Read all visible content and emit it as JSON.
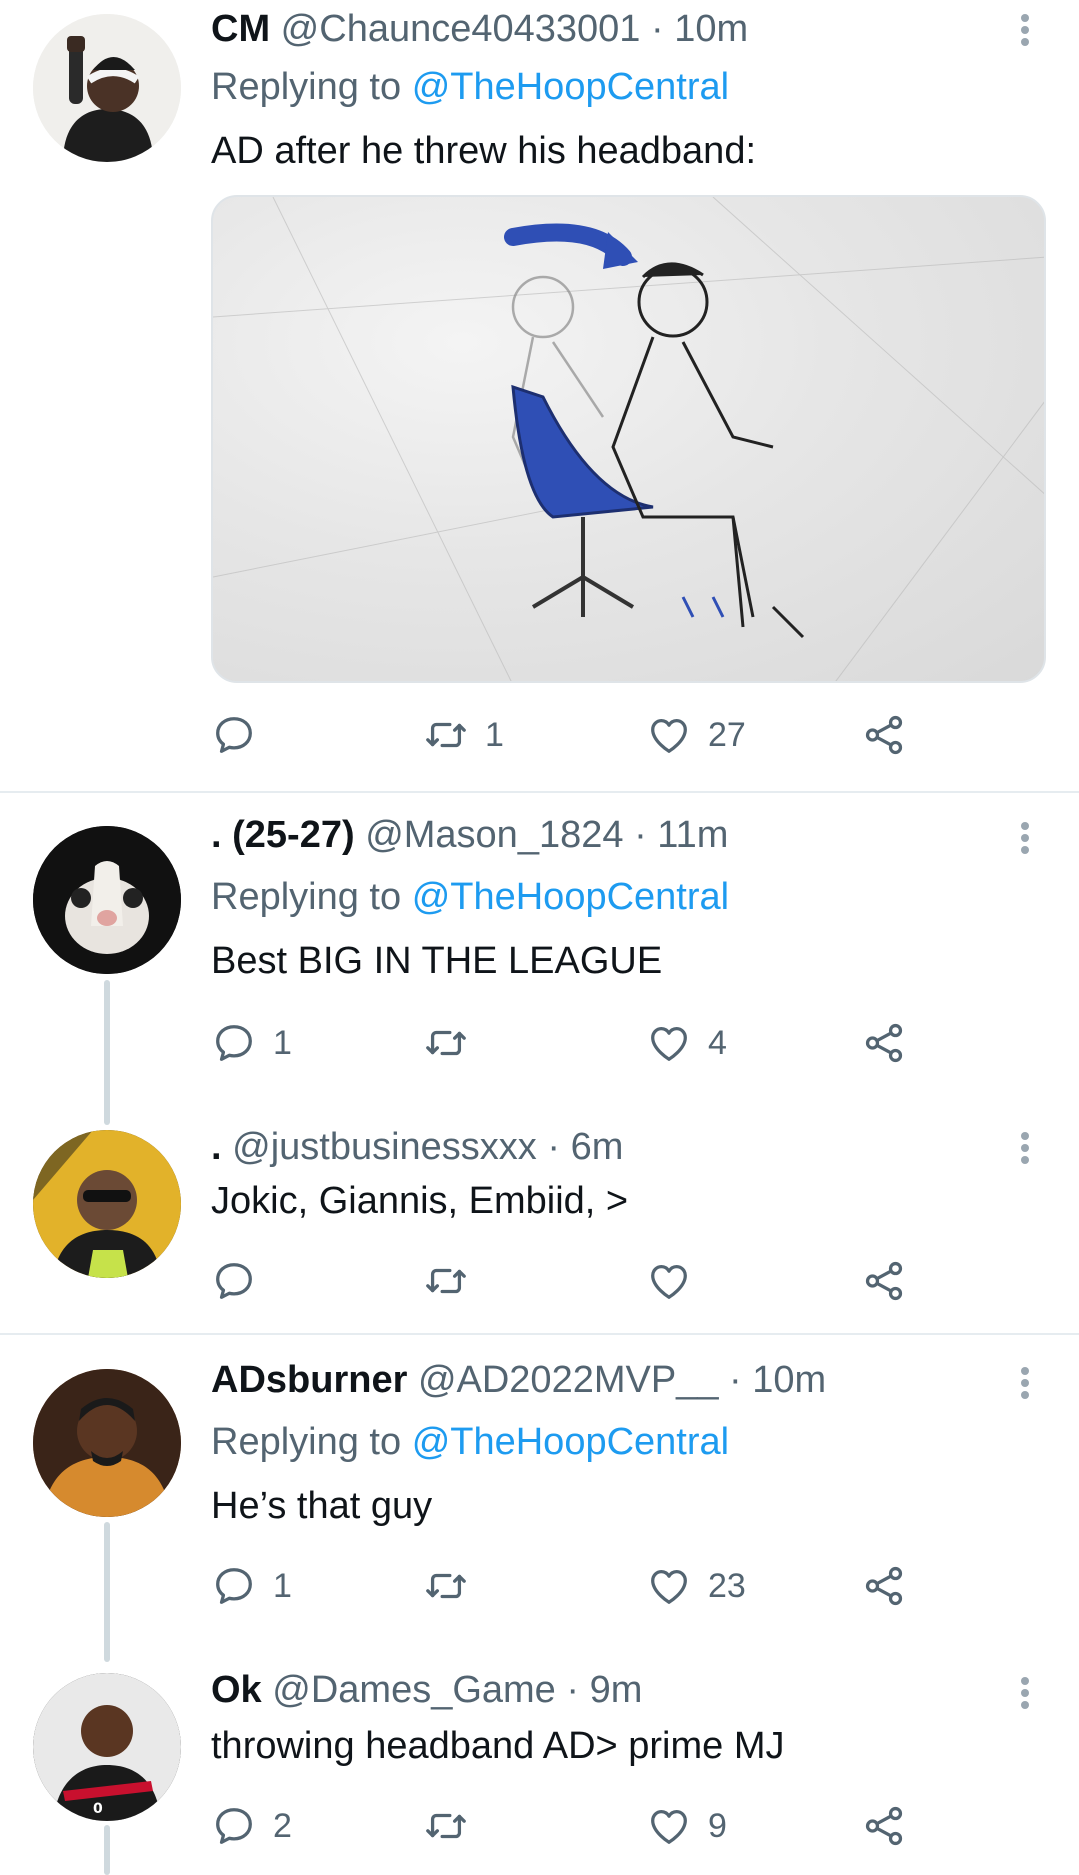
{
  "tweets": [
    {
      "name": "CM",
      "handle": "@Chaunce40433001",
      "time": "10m",
      "replying_label": "Replying to",
      "replying_handle": "@TheHoopCentral",
      "text": "AD after he threw his headband:",
      "reply_count": "",
      "retweet_count": "1",
      "like_count": "27"
    },
    {
      "name": ". (25-27)",
      "handle": "@Mason_1824",
      "time": "11m",
      "replying_label": "Replying to",
      "replying_handle": "@TheHoopCentral",
      "text": "Best BIG IN THE LEAGUE",
      "reply_count": "1",
      "retweet_count": "",
      "like_count": "4"
    },
    {
      "name": ".",
      "handle": "@justbusinessxxx",
      "time": "6m",
      "text": "Jokic, Giannis, Embiid, >",
      "reply_count": "",
      "retweet_count": "",
      "like_count": ""
    },
    {
      "name": "ADsburner",
      "handle": "@AD2022MVP__",
      "time": "10m",
      "replying_label": "Replying to",
      "replying_handle": "@TheHoopCentral",
      "text": "He’s that guy",
      "reply_count": "1",
      "retweet_count": "",
      "like_count": "23"
    },
    {
      "name": "Ok",
      "handle": "@Dames_Game",
      "time": "9m",
      "text": "throwing headband AD> prime MJ",
      "reply_count": "2",
      "retweet_count": "",
      "like_count": "9"
    }
  ],
  "separator": "·",
  "colors": {
    "link": "#1d9bf0",
    "secondary_text": "#536471",
    "thread_line": "#cfd9de",
    "chair_blue": "#2f4fb5"
  },
  "icons": [
    "reply-icon",
    "retweet-icon",
    "like-icon",
    "share-icon",
    "more-icon"
  ]
}
